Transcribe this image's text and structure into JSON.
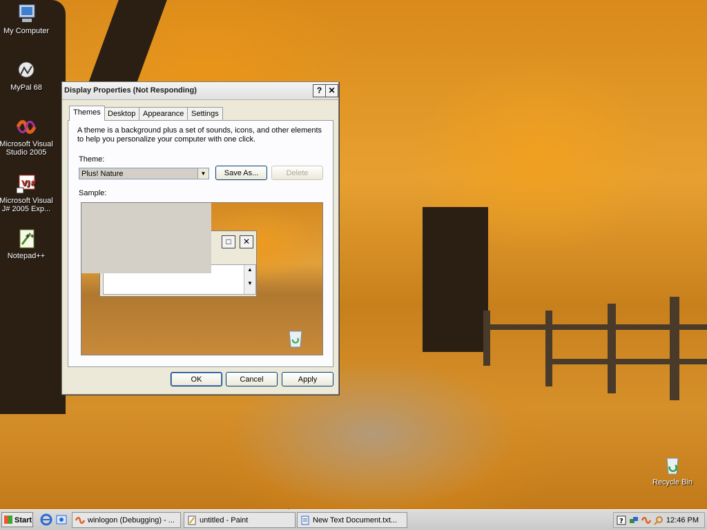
{
  "desktop": {
    "icons": [
      {
        "label": "My Computer"
      },
      {
        "label": "MyPal 68"
      },
      {
        "label": "Microsoft Visual Studio 2005"
      },
      {
        "label": "Microsoft Visual J# 2005 Exp..."
      },
      {
        "label": "Notepad++"
      },
      {
        "label": "Recycle Bin"
      }
    ]
  },
  "dialog": {
    "title": "Display Properties (Not Responding)",
    "help_glyph": "?",
    "close_glyph": "✕",
    "tabs": [
      {
        "label": "Themes"
      },
      {
        "label": "Desktop"
      },
      {
        "label": "Appearance"
      },
      {
        "label": "Settings"
      }
    ],
    "description": "A theme is a background plus a set of sounds, icons, and other elements to help you personalize your computer with one click.",
    "theme_label": "Theme:",
    "theme_value": "Plus! Nature",
    "save_as_label": "Save As...",
    "delete_label": "Delete",
    "sample_label": "Sample:",
    "ok_label": "OK",
    "cancel_label": "Cancel",
    "apply_label": "Apply"
  },
  "taskbar": {
    "start_label": "Start",
    "tasks": [
      {
        "label": "winlogon (Debugging) - ..."
      },
      {
        "label": "untitled - Paint"
      },
      {
        "label": "New Text Document.txt..."
      }
    ],
    "clock": "12:46 PM"
  }
}
